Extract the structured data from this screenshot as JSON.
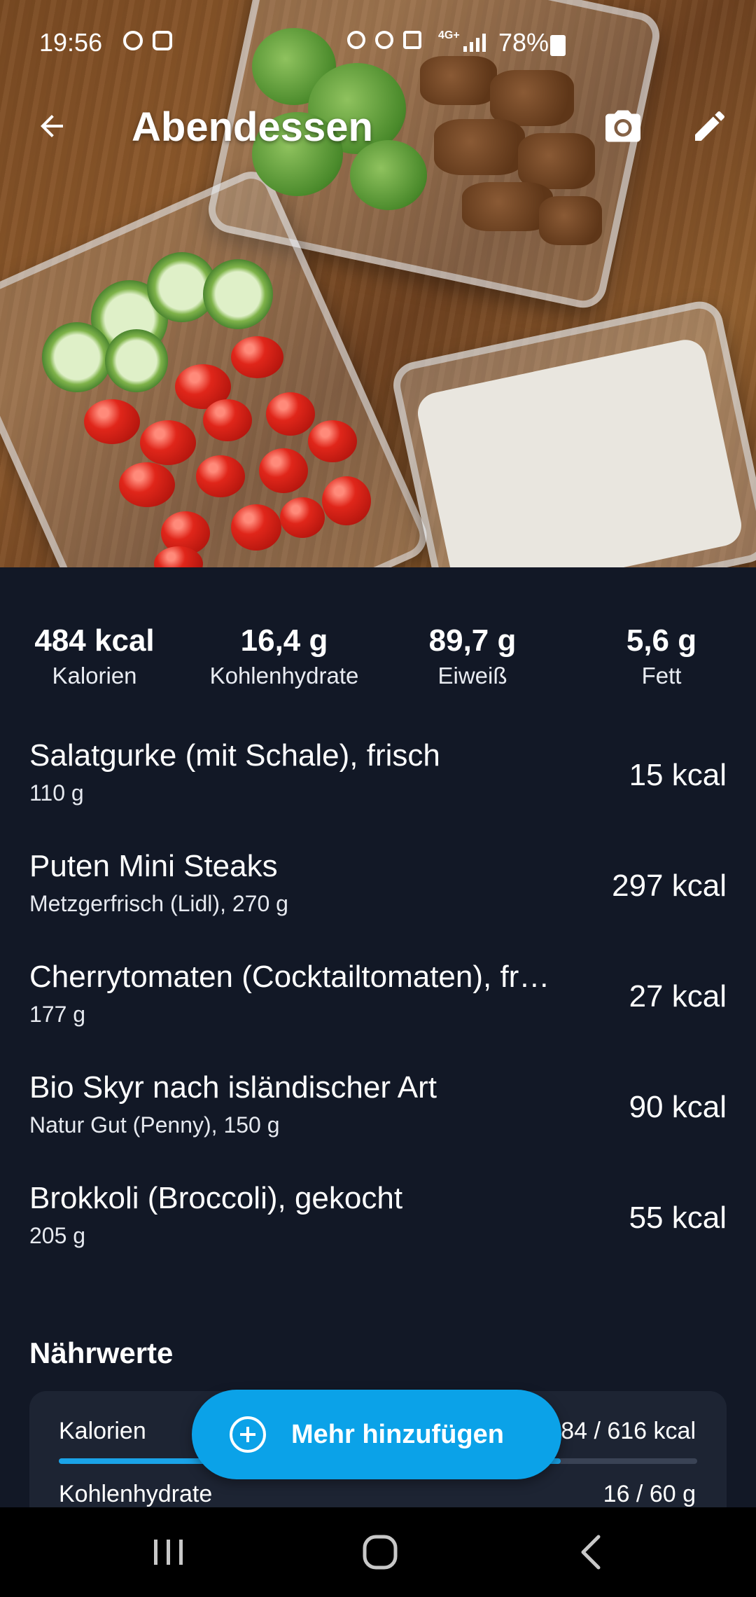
{
  "status_bar": {
    "time": "19:56",
    "network": "4G+",
    "battery": "78%"
  },
  "app_bar": {
    "title": "Abendessen",
    "back_icon": "arrow-back-icon",
    "camera_icon": "camera-icon",
    "edit_icon": "pencil-icon"
  },
  "summary": [
    {
      "value": "484 kcal",
      "label": "Kalorien"
    },
    {
      "value": "16,4 g",
      "label": "Kohlenhydrate"
    },
    {
      "value": "89,7 g",
      "label": "Eiweiß"
    },
    {
      "value": "5,6 g",
      "label": "Fett"
    }
  ],
  "foods": [
    {
      "name": "Salatgurke (mit Schale), frisch",
      "detail": "110 g",
      "kcal": "15 kcal"
    },
    {
      "name": "Puten Mini Steaks",
      "detail": "Metzgerfrisch (Lidl), 270 g",
      "kcal": "297 kcal"
    },
    {
      "name": "Cherrytomaten (Cocktailtomaten), fr…",
      "detail": "177 g",
      "kcal": "27 kcal"
    },
    {
      "name": "Bio Skyr nach isländischer Art",
      "detail": "Natur Gut (Penny), 150 g",
      "kcal": "90 kcal"
    },
    {
      "name": "Brokkoli (Broccoli), gekocht",
      "detail": "205 g",
      "kcal": "55 kcal"
    }
  ],
  "nutrients": {
    "title": "Nährwerte",
    "rows": [
      {
        "label": "Kalorien",
        "value": "484 / 616 kcal",
        "progress": 0.786
      },
      {
        "label": "Kohlenhydrate",
        "value": "16 / 60 g",
        "progress": 0.27
      }
    ]
  },
  "fab": {
    "label": "Mehr hinzufügen",
    "icon": "plus-circle-icon"
  },
  "nav": {
    "recent_icon": "recent-apps-icon",
    "home_icon": "home-icon",
    "back_icon": "nav-back-icon"
  },
  "colors": {
    "background": "#121826",
    "card": "#1d2433",
    "accent": "#0ba2e8",
    "track": "#3a4355"
  }
}
